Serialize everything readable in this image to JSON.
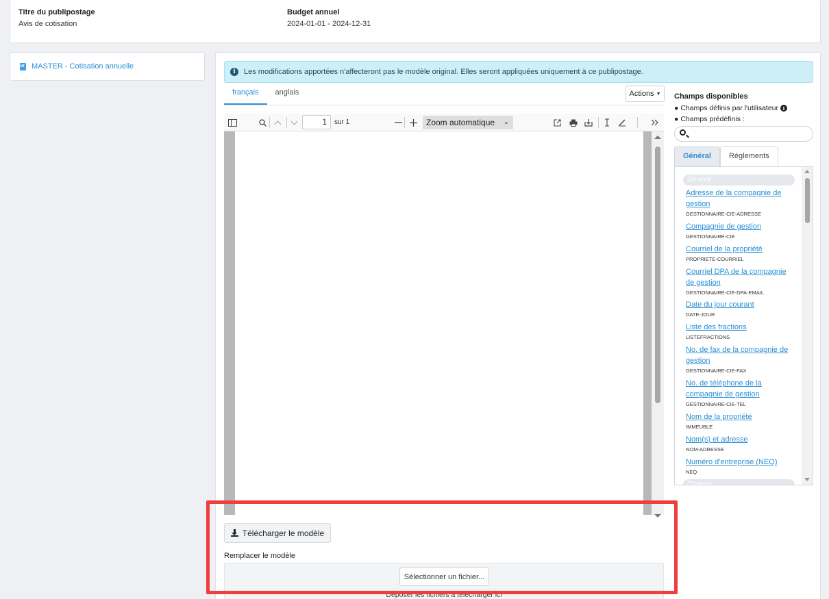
{
  "header": {
    "title_label": "Titre du publipostage",
    "title_value": "Avis de cotisation",
    "budget_label": "Budget annuel",
    "budget_value": "2024-01-01 - 2024-12-31"
  },
  "sidebar": {
    "template_item": "MASTER - Cotisation annuelle"
  },
  "alert": {
    "icon": "info-icon",
    "text": "Les modifications apportées n'affecteront pas le modèle original. Elles seront appliquées uniquement à ce publipostage."
  },
  "lang_tabs": [
    {
      "label": "français",
      "active": true
    },
    {
      "label": "anglais",
      "active": false
    }
  ],
  "actions_label": "Actions",
  "pdf_viewer": {
    "page_number": "1",
    "page_of": "sur 1",
    "zoom": "Zoom automatique"
  },
  "fields_panel": {
    "title": "Champs disponibles",
    "legend_user": "Champs définis par l'utilisateur",
    "legend_predefined": "Champs prédéfinis :",
    "tabs": [
      {
        "label": "Général",
        "active": true
      },
      {
        "label": "Règlements",
        "active": false
      }
    ],
    "group_general": "Général",
    "group_next": "Charges",
    "items": [
      {
        "label": "Adresse de la compagnie de gestion",
        "code": "GESTIONNAIRE-CIE-ADRESSE"
      },
      {
        "label": "Compagnie de gestion",
        "code": "GESTIONNAIRE-CIE"
      },
      {
        "label": "Courriel de la propriété",
        "code": "PROPRIETE-COURRIEL"
      },
      {
        "label": "Courriel DPA de la compagnie de gestion",
        "code": "GESTIONNAIRE-CIE-DPA-EMAIL"
      },
      {
        "label": "Date du jour courant",
        "code": "DATE-JOUR"
      },
      {
        "label": "Liste des fractions",
        "code": "LISTEFRACTIONS"
      },
      {
        "label": "No. de fax de la compagnie de gestion",
        "code": "GESTIONNAIRE-CIE-FAX"
      },
      {
        "label": "No. de téléphone de la compagnie de gestion",
        "code": "GESTIONNAIRE-CIE-TEL"
      },
      {
        "label": "Nom de la propriété",
        "code": "IMMEUBLE"
      },
      {
        "label": "Nom(s) et adresse",
        "code": "NOM-ADRESSE"
      },
      {
        "label": "Numéro d'entreprise (NEQ)",
        "code": "NEQ"
      }
    ]
  },
  "bottom": {
    "download_label": "Télécharger le modèle",
    "replace_label": "Remplacer le modèle",
    "select_file_label": "Sélectionner un fichier...",
    "drop_text": "Déposer les fichiers à télécharger ici"
  },
  "colors": {
    "accent": "#2a8fd6",
    "alert_bg": "#cdeff8",
    "highlight": "#f03e3e"
  }
}
